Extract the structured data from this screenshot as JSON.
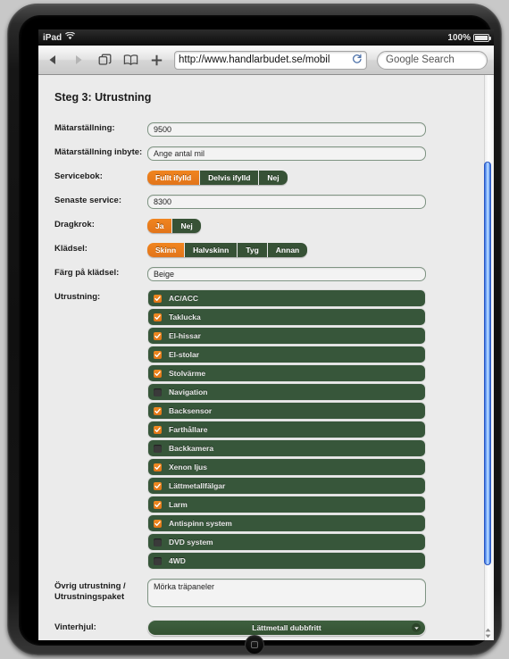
{
  "statusbar": {
    "device": "iPad",
    "wifi_icon": "wifi-icon",
    "battery_pct": "100%"
  },
  "toolbar": {
    "back_icon": "back-arrow-icon",
    "forward_icon": "forward-arrow-icon",
    "tabs_icon": "tabs-icon",
    "bookmarks_icon": "bookmarks-book-icon",
    "new_tab_icon": "plus-icon",
    "url": "http://www.handlarbudet.se/mobil",
    "reload_icon": "reload-icon",
    "search_placeholder": "Google Search"
  },
  "form": {
    "title": "Steg 3: Utrustning",
    "fields": {
      "odometer": {
        "label": "Mätarställning:",
        "value": "9500"
      },
      "odometer_tradein": {
        "label": "Mätarställning inbyte:",
        "value": "",
        "placeholder": "Ange antal mil"
      },
      "servicebook": {
        "label": "Servicebok:",
        "options": [
          "Fullt ifylld",
          "Delvis ifylld",
          "Nej"
        ],
        "selected": "Fullt ifylld"
      },
      "last_service": {
        "label": "Senaste service:",
        "value": "8300"
      },
      "towbar": {
        "label": "Dragkrok:",
        "options": [
          "Ja",
          "Nej"
        ],
        "selected": "Ja"
      },
      "upholstery": {
        "label": "Klädsel:",
        "options": [
          "Skinn",
          "Halvskinn",
          "Tyg",
          "Annan"
        ],
        "selected": "Skinn"
      },
      "upholstery_color": {
        "label": "Färg på klädsel:",
        "value": "Beige"
      },
      "equipment": {
        "label": "Utrustning:",
        "items": [
          {
            "label": "AC/ACC",
            "checked": true
          },
          {
            "label": "Taklucka",
            "checked": true
          },
          {
            "label": "El-hissar",
            "checked": true
          },
          {
            "label": "El-stolar",
            "checked": true
          },
          {
            "label": "Stolvärme",
            "checked": true
          },
          {
            "label": "Navigation",
            "checked": false
          },
          {
            "label": "Backsensor",
            "checked": true
          },
          {
            "label": "Farthållare",
            "checked": true
          },
          {
            "label": "Backkamera",
            "checked": false
          },
          {
            "label": "Xenon ljus",
            "checked": true
          },
          {
            "label": "Lättmetallfälgar",
            "checked": true
          },
          {
            "label": "Larm",
            "checked": true
          },
          {
            "label": "Antispinn system",
            "checked": true
          },
          {
            "label": "DVD system",
            "checked": false
          },
          {
            "label": "4WD",
            "checked": false
          }
        ]
      },
      "other_equipment": {
        "label": "Övrig utrustning / Utrustningspaket",
        "value": "Mörka träpaneler"
      },
      "winter_wheels": {
        "label": "Vinterhjul:",
        "selected": "Lättmetall dubbfritt",
        "arrow_icon": "chevron-down-icon"
      }
    }
  },
  "colors": {
    "accent_orange": "#e8801e",
    "panel_green": "#37563a",
    "page_bg": "#ebebeb",
    "scrollbar_blue": "#3a6fe0"
  }
}
